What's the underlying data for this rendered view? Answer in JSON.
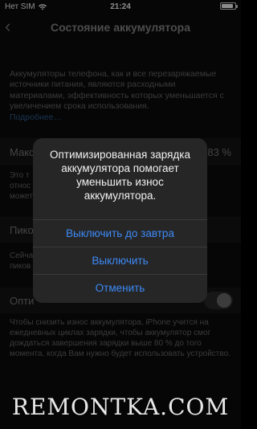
{
  "status": {
    "carrier": "Нет SIM",
    "time": "21:24",
    "battery_level": 0.85
  },
  "nav": {
    "title": "Состояние аккумулятора",
    "back_icon": "chevron-left-icon"
  },
  "intro": {
    "text": "Аккумуляторы телефона, как и все перезаряжаемые источники питания, являются расходными материалами, эффективность которых уменьшается с увеличением срока использования.",
    "more_link": "Подробнее…"
  },
  "capacity": {
    "label": "Макс",
    "value": "83 %",
    "note_line1": "Это т",
    "note_line2": "относ",
    "note_line3": "может"
  },
  "peak": {
    "label": "Пико",
    "note_line1": "Сейча",
    "note_line2": "пиков"
  },
  "optimized": {
    "label": "Опти",
    "enabled": false,
    "footer": "Чтобы снизить износ аккумулятора, iPhone учится на ежедневных циклах зарядки, чтобы аккумулятор смог дождаться завершения зарядки выше 80 % до того момента, когда Вам нужно будет использовать устройство."
  },
  "alert": {
    "message": "Оптимизированная зарядка аккумулятора помогает уменьшить износ аккумулятора.",
    "buttons": [
      "Выключить до завтра",
      "Выключить",
      "Отменить"
    ]
  },
  "watermark": "REMONTKA.COM"
}
